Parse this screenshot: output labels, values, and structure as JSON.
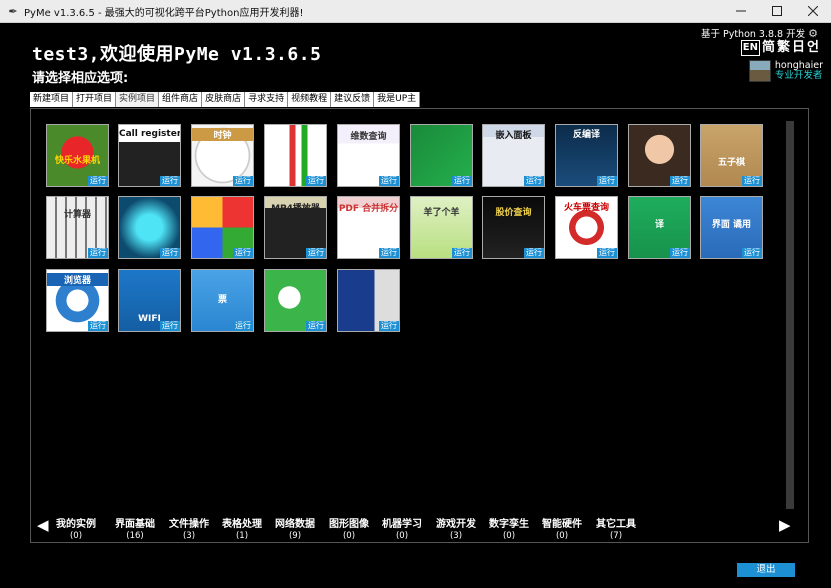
{
  "window": {
    "title": "PyMe v1.3.6.5 -  最强大的可视化跨平台Python应用开发利器!"
  },
  "header": {
    "title": "test3,欢迎使用PyMe v1.3.6.5",
    "subtitle": "请选择相应选项:",
    "python_info": "基于 Python 3.8.8 开发",
    "languages": [
      "EN",
      "简",
      "繁",
      "日",
      "언"
    ],
    "user": {
      "name": "honghaier",
      "role": "专业开发者"
    }
  },
  "tabs": [
    "新建项目",
    "打开项目",
    "实例项目",
    "组件商店",
    "皮肤商店",
    "寻求支持",
    "视频教程",
    "建议反馈",
    "我是UP主"
  ],
  "active_tab": "实例项目",
  "run_label": "运行",
  "tiles": [
    {
      "name": "fruit-machine",
      "label": "快乐水果机"
    },
    {
      "name": "call-register",
      "label": "Call register"
    },
    {
      "name": "clock",
      "label": "时钟"
    },
    {
      "name": "people",
      "label": ""
    },
    {
      "name": "sqlite",
      "label": "维数查询"
    },
    {
      "name": "mp4-player",
      "label": ""
    },
    {
      "name": "embedded-panel",
      "label": "嵌入面板"
    },
    {
      "name": "decompile",
      "label": "反编译"
    },
    {
      "name": "face",
      "label": ""
    },
    {
      "name": "gomoku",
      "label": "五子棋"
    },
    {
      "name": "calculator",
      "label": "计算器"
    },
    {
      "name": "robot",
      "label": ""
    },
    {
      "name": "wheel",
      "label": ""
    },
    {
      "name": "mp4-player-2",
      "label": "MP4播放器"
    },
    {
      "name": "pdf-split",
      "label": "PDF 合并拆分"
    },
    {
      "name": "sheep",
      "label": "羊了个羊"
    },
    {
      "name": "stock",
      "label": "股价查询"
    },
    {
      "name": "train",
      "label": "火车票查询"
    },
    {
      "name": "translate",
      "label": "译"
    },
    {
      "name": "ui-apply",
      "label": "界面 谲用"
    },
    {
      "name": "browser",
      "label": "浏览器"
    },
    {
      "name": "wifi",
      "label": "WIFI"
    },
    {
      "name": "invoice-scan",
      "label": "票"
    },
    {
      "name": "wechat",
      "label": ""
    },
    {
      "name": "photo",
      "label": ""
    }
  ],
  "categories": [
    {
      "name": "我的实例",
      "count": "(0)"
    },
    {
      "name": "界面基础",
      "count": "(16)"
    },
    {
      "name": "文件操作",
      "count": "(3)"
    },
    {
      "name": "表格处理",
      "count": "(1)"
    },
    {
      "name": "网络数据",
      "count": "(9)"
    },
    {
      "name": "图形图像",
      "count": "(0)"
    },
    {
      "name": "机器学习",
      "count": "(0)"
    },
    {
      "name": "游戏开发",
      "count": "(3)"
    },
    {
      "name": "数字孪生",
      "count": "(0)"
    },
    {
      "name": "智能硬件",
      "count": "(0)"
    },
    {
      "name": "其它工具",
      "count": "(7)"
    }
  ],
  "exit_label": "退出",
  "colors": {
    "accent": "#1d8fd3",
    "role": "#2ad0d0"
  }
}
